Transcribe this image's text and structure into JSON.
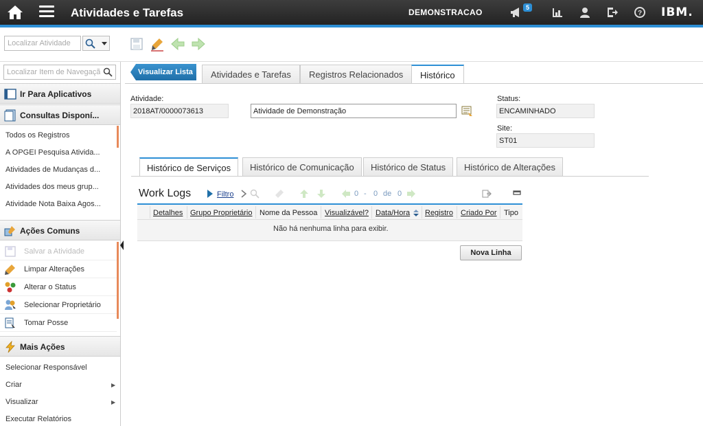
{
  "topbar": {
    "app_title": "Atividades e Tarefas",
    "user_label": "DEMONSTRACAO",
    "notification_count": "5",
    "brand": "IBM."
  },
  "toolbar": {
    "find_placeholder": "Localizar Atividade"
  },
  "leftnav": {
    "search_placeholder": "Localizar Item de Navegação",
    "goto_apps": "Ir Para Aplicativos",
    "queries_header": "Consultas Disponí...",
    "queries": [
      "Todos os Registros",
      "A OPGEI Pesquisa Ativida...",
      "Atividades de Mudanças d...",
      "Atividades dos meus grup...",
      "Atividade Nota Baixa Agos..."
    ],
    "common_header": "Ações Comuns",
    "common_actions": [
      "Salvar a Atividade",
      "Limpar Alterações",
      "Alterar o Status",
      "Selecionar Proprietário",
      "Tomar Posse"
    ],
    "more_header": "Mais Ações",
    "more_actions": [
      "Selecionar Responsável",
      "Criar",
      "Visualizar",
      "Executar Relatórios"
    ]
  },
  "tabs": {
    "list_button": "Visualizar Lista",
    "items": [
      "Atividades e Tarefas",
      "Registros Relacionados",
      "Histórico"
    ],
    "active": "Histórico"
  },
  "form": {
    "activity_label": "Atividade:",
    "activity_id": "2018AT/0000073613",
    "description": "Atividade de Demonstração",
    "status_label": "Status:",
    "status_value": "ENCAMINHADO",
    "site_label": "Site:",
    "site_value": "ST01"
  },
  "subtabs": {
    "items": [
      "Histórico de Serviços",
      "Histórico de Comunicação",
      "Histórico de Status",
      "Histórico de Alterações"
    ],
    "active": "Histórico de Serviços"
  },
  "worklogs": {
    "title": "Work Logs",
    "filter_label": "Filtro",
    "pager": {
      "from": "0",
      "to": "0",
      "sep_dash": "-",
      "sep_of": "de",
      "total": "0"
    },
    "columns": [
      "Detalhes",
      "Grupo Proprietário",
      "Nome da Pessoa",
      "Visualizável?",
      "Data/Hora",
      "Registro",
      "Criado Por",
      "Tipo"
    ],
    "empty_message": "Não há nenhuma linha para exibir.",
    "new_row_button": "Nova Linha"
  },
  "colors": {
    "accent": "#2d8fd5",
    "topbar": "#2b2b2b",
    "scroll_accent": "#e88a5a"
  }
}
